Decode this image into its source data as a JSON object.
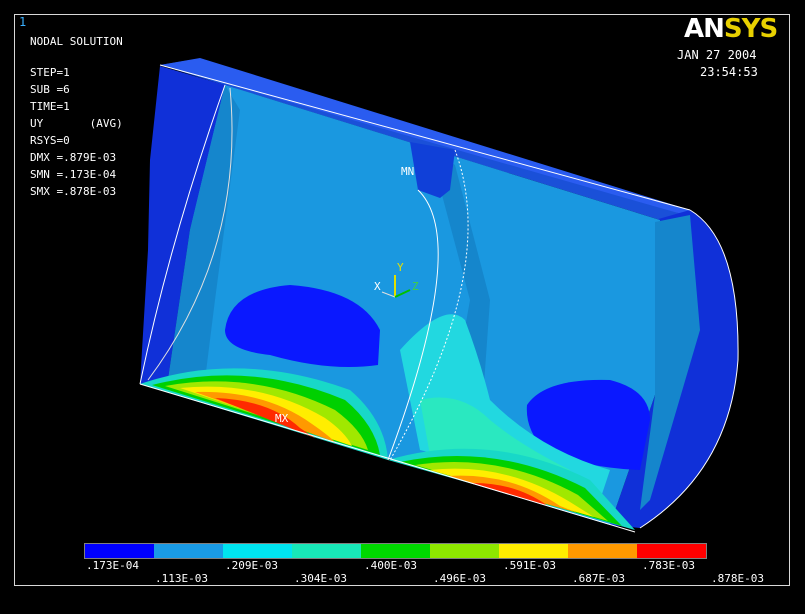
{
  "window_number": "1",
  "logo": {
    "an": "AN",
    "sys": "SYS"
  },
  "date": "JAN 27 2004",
  "time": "23:54:53",
  "info_lines": [
    "NODAL SOLUTION",
    "",
    "STEP=1",
    "SUB =6",
    "TIME=1",
    "UY       (AVG)",
    "RSYS=0",
    "DMX =.879E-03",
    "SMN =.173E-04",
    "SMX =.878E-03"
  ],
  "markers": {
    "mn": "MN",
    "mx": "MX"
  },
  "triad": {
    "x": "X",
    "y": "Y",
    "z": "Z"
  },
  "legend": {
    "colors": [
      "#0000ff",
      "#1a9be6",
      "#00e5f0",
      "#18e8b8",
      "#00d800",
      "#8ee800",
      "#ffee00",
      "#ff9900",
      "#ff0000"
    ],
    "labels_top": [
      ".173E-04",
      ".209E-03",
      ".400E-03",
      ".591E-03",
      ".783E-03"
    ],
    "labels_bottom": [
      ".113E-03",
      ".304E-03",
      ".496E-03",
      ".687E-03",
      ".878E-03"
    ]
  }
}
